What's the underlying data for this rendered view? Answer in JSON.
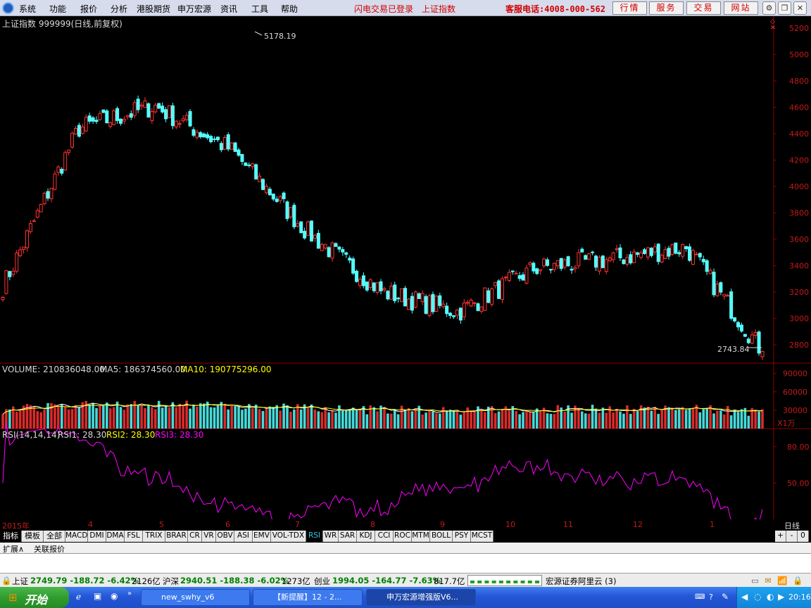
{
  "menu": {
    "items": [
      "系统",
      "功能",
      "报价",
      "分析",
      "港股期货",
      "申万宏源",
      "资讯",
      "工具",
      "帮助"
    ],
    "login_status": "闪电交易已登录",
    "index_name": "上证指数",
    "hotline": "客服电话:4008-000-562",
    "buttons": [
      "行情",
      "服务",
      "交易",
      "网站"
    ]
  },
  "main": {
    "title": "上证指数 999999(日线,前复权)",
    "high_label": "5178.19",
    "low_label": "2743.84",
    "y_ticks": [
      "5200",
      "5000",
      "4800",
      "4600",
      "4400",
      "4200",
      "4000",
      "3800",
      "3600",
      "3400",
      "3200",
      "3000",
      "2800"
    ]
  },
  "volume": {
    "label": "VOLUME: 210836048.00",
    "ma5": "MA5: 186374560.00",
    "ma10": "MA10: 190775296.00",
    "y_ticks": [
      "90000",
      "60000",
      "30000"
    ],
    "unit": "X1万"
  },
  "rsi": {
    "label": "RSI(14,14,14)",
    "rsi1": "RSI1: 28.30",
    "rsi2": "RSI2: 28.30",
    "rsi3": "RSI3: 28.30",
    "y_ticks": [
      "80.00",
      "50.00"
    ]
  },
  "date_axis": {
    "labels": [
      "2015年",
      "4",
      "5",
      "6",
      "7",
      "8",
      "9",
      "10",
      "11",
      "12",
      "1"
    ],
    "period": "日线"
  },
  "indicator_tabs": [
    "指标",
    "模板",
    "全部",
    "MACD",
    "DMI",
    "DMA",
    "FSL",
    "TRIX",
    "BRAR",
    "CR",
    "VR",
    "OBV",
    "ASI",
    "EMV",
    "VOL-TDX",
    "RSI",
    "WR",
    "SAR",
    "KDJ",
    "CCI",
    "ROC",
    "MTM",
    "BOLL",
    "PSY",
    "MCST"
  ],
  "indicator_controls": [
    "+",
    "-",
    "0"
  ],
  "sub_tabs": [
    "扩展∧",
    "关联报价"
  ],
  "status": {
    "sh_name": "上证",
    "sh_value": "2749.79 -188.72 -6.42%",
    "sh_amount": "2126亿",
    "hs_name": "沪深",
    "hs_value": "2940.51 -188.38 -6.02%",
    "hs_amount": "1273亿",
    "cy_name": "创业",
    "cy_value": "1994.05 -164.77 -7.63%",
    "cy_amount": "817.7亿",
    "server": "宏源证券阿里云 (3)"
  },
  "taskbar": {
    "start_label": "开始",
    "windows": [
      "new_swhy_v6",
      "【新提醒】12 - 2...",
      "申万宏源增强版V6..."
    ],
    "clock": "20:16"
  },
  "colors": {
    "up": "#ff3232",
    "down": "#54ffff",
    "ma5": "#ffffff",
    "ma10": "#ffff00",
    "rsi": "#ff00ff",
    "grid": "#8b0000",
    "axis_text": "#c41a1a"
  },
  "chart_data": {
    "type": "candlestick",
    "title": "上证指数 999999(日线,前复权)",
    "x_range": [
      "2015-03",
      "2016-01"
    ],
    "y_range": [
      2700,
      5200
    ],
    "annotations": [
      {
        "label": "5178.19",
        "type": "high"
      },
      {
        "label": "2743.84",
        "type": "low"
      }
    ],
    "close_points": [
      {
        "date": "2015-03",
        "close": 3240
      },
      {
        "date": "2015-04",
        "close": 4440
      },
      {
        "date": "2015-05",
        "close": 4610
      },
      {
        "date": "2015-06",
        "close": 4280
      },
      {
        "date": "2015-07",
        "close": 3660
      },
      {
        "date": "2015-08",
        "close": 3200
      },
      {
        "date": "2015-09",
        "close": 3050
      },
      {
        "date": "2015-10",
        "close": 3380
      },
      {
        "date": "2015-11",
        "close": 3450
      },
      {
        "date": "2015-12",
        "close": 3540
      },
      {
        "date": "2016-01",
        "close": 2750
      }
    ],
    "volume_series": {
      "ma5": 186374560.0,
      "ma10": 190775296.0
    },
    "rsi_last": 28.3
  }
}
